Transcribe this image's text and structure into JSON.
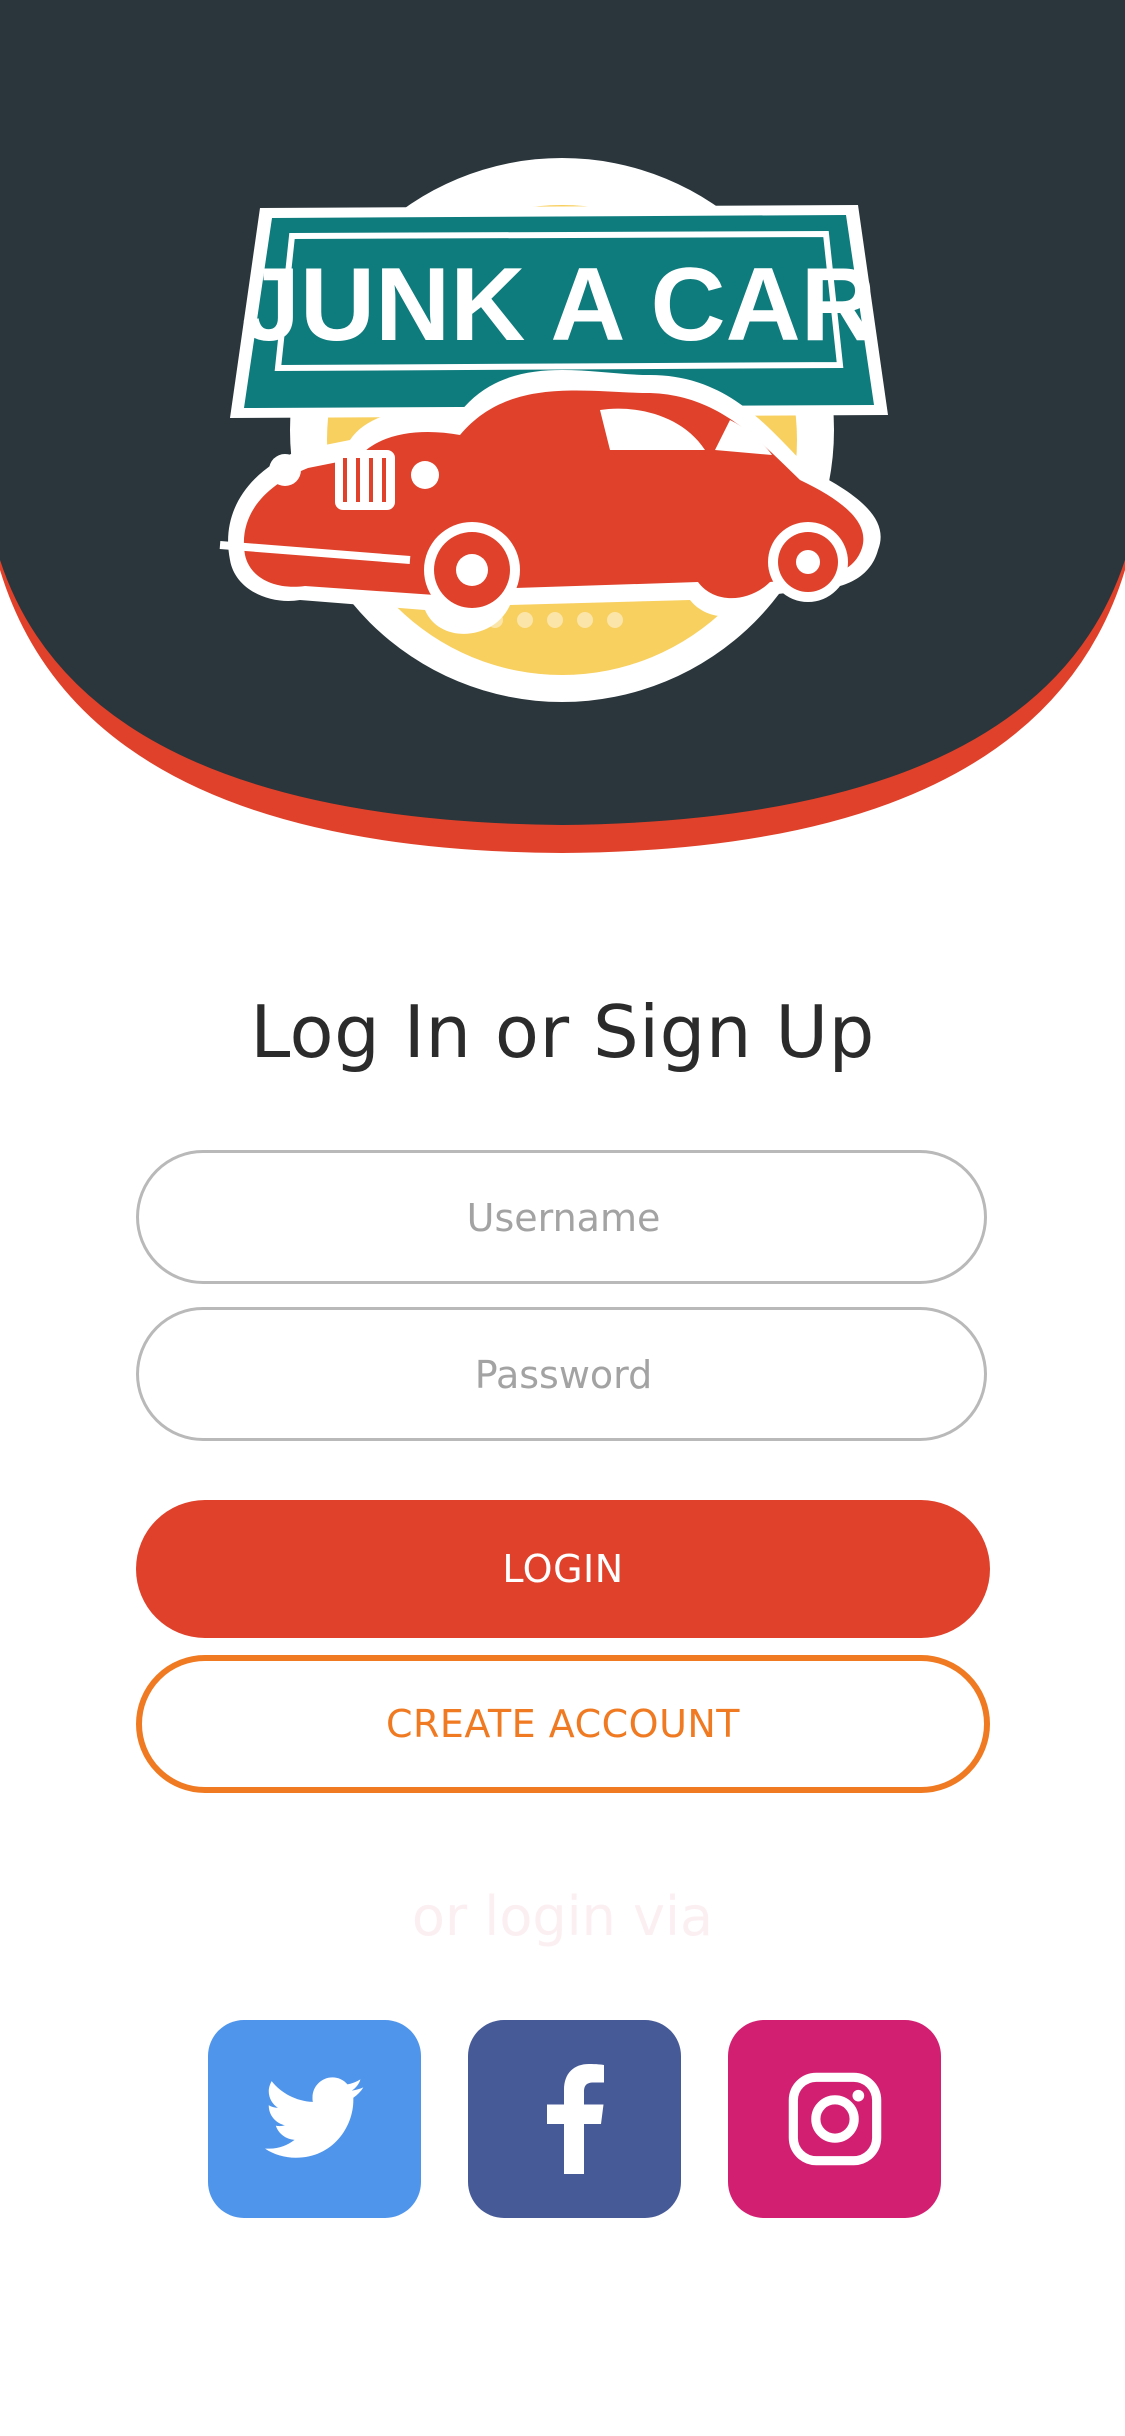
{
  "brand": {
    "logo_text": "JUNK A CAR",
    "colors": {
      "header_bg": "#2a363b",
      "header_border": "#e0412a",
      "banner": "#0e7b7d",
      "car": "#e0412a",
      "sun": "#f8d060"
    }
  },
  "auth": {
    "title": "Log In or Sign Up",
    "username_placeholder": "Username",
    "password_placeholder": "Password",
    "login_label": "LOGIN",
    "create_account_label": "CREATE ACCOUNT",
    "alt_login_text": "or login via"
  },
  "social": [
    {
      "name": "twitter",
      "icon": "twitter-icon",
      "color": "#4f95ec"
    },
    {
      "name": "facebook",
      "icon": "facebook-icon",
      "color": "#475a98"
    },
    {
      "name": "instagram",
      "icon": "instagram-icon",
      "color": "#d31f72"
    }
  ]
}
